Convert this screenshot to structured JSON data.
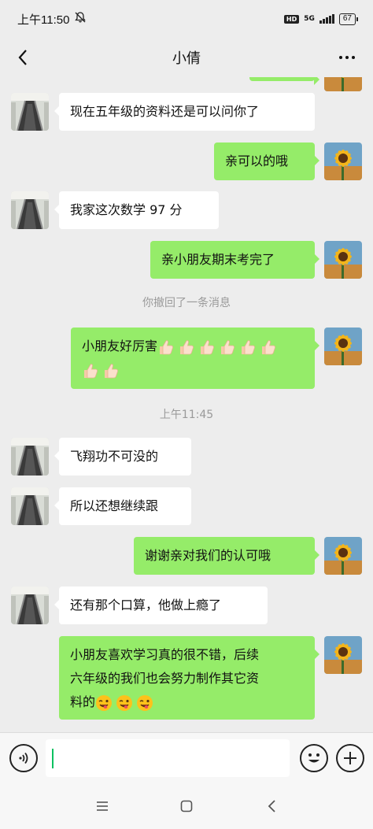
{
  "status_bar": {
    "time": "上午11:50",
    "mute_icon": "bell-off-icon",
    "hd_label": "HD",
    "network_label": "5G",
    "battery_level": "67"
  },
  "header": {
    "title": "小倩",
    "back_icon": "chevron-left-icon",
    "more_icon": "more-dots-icon"
  },
  "messages": [
    {
      "side": "left",
      "text": "现在五年级的资料还是可以问你了"
    },
    {
      "side": "right",
      "text": "亲可以的哦"
    },
    {
      "side": "left",
      "text": "我家这次数学 97 分"
    },
    {
      "side": "right",
      "text": "亲小朋友期末考完了"
    },
    {
      "type": "system",
      "text": "你撤回了一条消息"
    },
    {
      "side": "right",
      "text": "小朋友好厉害",
      "emoji": "thumbs-up",
      "emoji_count": 8
    },
    {
      "type": "time",
      "text": "上午11:45"
    },
    {
      "side": "left",
      "text": "飞翔功不可没的"
    },
    {
      "side": "left",
      "text": "所以还想继续跟"
    },
    {
      "side": "right",
      "text": "谢谢亲对我们的认可哦"
    },
    {
      "side": "left",
      "text": "还有那个口算，他做上瘾了"
    },
    {
      "side": "right",
      "line1": "小朋友喜欢学习真的很不错，后续",
      "line2": "六年级的我们也会努力制作其它资",
      "line3": "料的",
      "emoji": "winking-tongue-face",
      "emoji_count": 3
    }
  ],
  "input_bar": {
    "voice_icon": "voice-icon",
    "emoji_icon": "emoji-face-icon",
    "plus_icon": "plus-icon",
    "value": ""
  },
  "nav_bar": {
    "menu_icon": "menu-icon",
    "home_icon": "home-square-icon",
    "back_icon": "back-triangle-icon"
  },
  "colors": {
    "background": "#ededed",
    "bubble_right": "#95ec69",
    "bubble_left": "#ffffff",
    "system_text": "#9a9a9a",
    "cursor": "#07c160"
  }
}
